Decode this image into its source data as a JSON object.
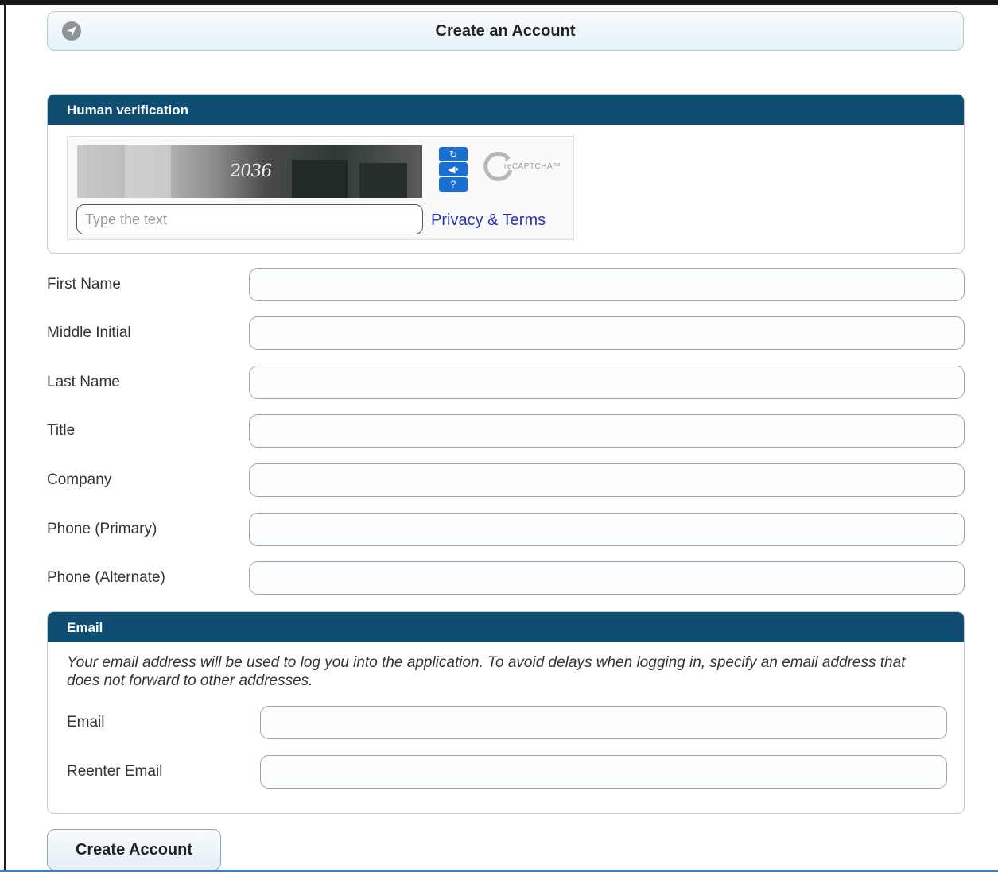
{
  "header": {
    "title": "Create an Account",
    "icon": "navigation-arrow-icon"
  },
  "human_verification": {
    "title": "Human verification",
    "captcha_text": "2036",
    "input_placeholder": "Type the text",
    "input_value": "",
    "privacy_link": "Privacy & Terms",
    "logo_text": "reCAPTCHA™",
    "buttons": [
      "refresh-icon",
      "audio-icon",
      "help-icon"
    ]
  },
  "fields": [
    {
      "label": "First Name",
      "value": ""
    },
    {
      "label": "Middle Initial",
      "value": ""
    },
    {
      "label": "Last Name",
      "value": ""
    },
    {
      "label": "Title",
      "value": ""
    },
    {
      "label": "Company",
      "value": ""
    },
    {
      "label": "Phone (Primary)",
      "value": ""
    },
    {
      "label": "Phone (Alternate)",
      "value": ""
    }
  ],
  "email": {
    "title": "Email",
    "note": "Your email address will be used to log you into the application. To avoid delays when logging in, specify an email address that does not forward to other addresses.",
    "email_label": "Email",
    "email_value": "",
    "reenter_label": "Reenter Email",
    "reenter_value": ""
  },
  "submit_label": "Create Account",
  "colors": {
    "panel_header": "#0f4d72",
    "link": "#2a35b5",
    "captcha_button": "#1a6fd0"
  }
}
